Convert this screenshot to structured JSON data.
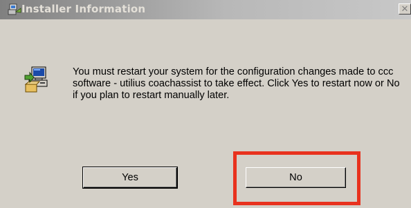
{
  "window": {
    "title": "Installer Information",
    "close_glyph": "✕",
    "title_icon": "installer-icon"
  },
  "dialog": {
    "icon": "computer-install-icon",
    "message": "You must restart your system for the configuration changes made to ccc software - utilius coachassist to take effect. Click Yes to restart now or No if you plan to restart manually later."
  },
  "buttons": {
    "yes_label": "Yes",
    "no_label": "No"
  },
  "colors": {
    "dialog_bg": "#d4d0c8",
    "highlight": "#e8321e"
  }
}
